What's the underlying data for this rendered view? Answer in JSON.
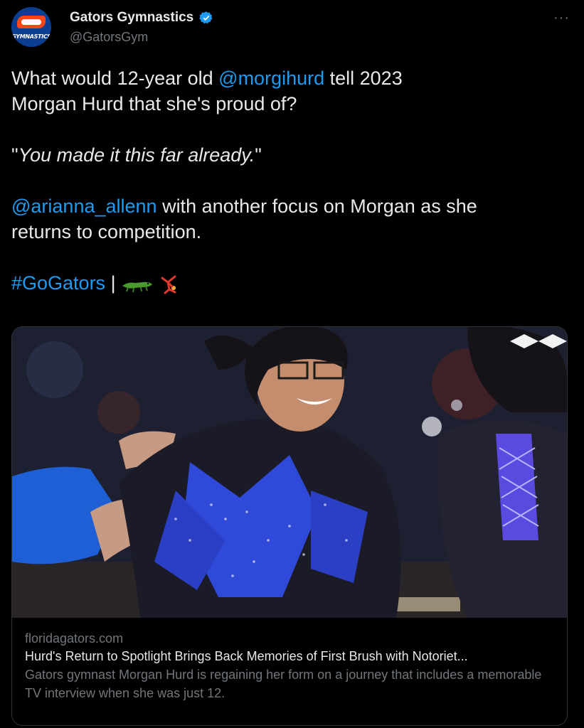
{
  "author": {
    "display_name": "Gators Gymnastics",
    "handle": "@GatorsGym",
    "avatar_text": "GYMNASTICS",
    "more_label": "···"
  },
  "tweet": {
    "line1_pre": "What would 12-year old ",
    "mention1": "@morgihurd",
    "line1_post": " tell 2023",
    "line2": "Morgan Hurd that she's proud of?",
    "quote_open": "\"",
    "quote_text": "You made it this far already.",
    "quote_close": "\"",
    "mention2": "@arianna_allenn",
    "line4_post": " with another focus on Morgan as she",
    "line5": "returns to competition.",
    "hashtag": "#GoGators",
    "separator": " |"
  },
  "card": {
    "domain": "floridagators.com",
    "title": "Hurd's Return to Spotlight Brings Back Memories of First Brush with Notoriet...",
    "description": "Gators gymnast Morgan Hurd is regaining her form on a journey that includes a memorable TV interview when she was just 12."
  },
  "colors": {
    "link": "#1d9bf0",
    "text": "#e7e9ea",
    "muted": "#71767b",
    "background": "#000000",
    "border": "#2f3336"
  },
  "icons": [
    "verified-badge-icon",
    "more-options-icon",
    "alligator-emoji",
    "cartwheel-emoji"
  ]
}
